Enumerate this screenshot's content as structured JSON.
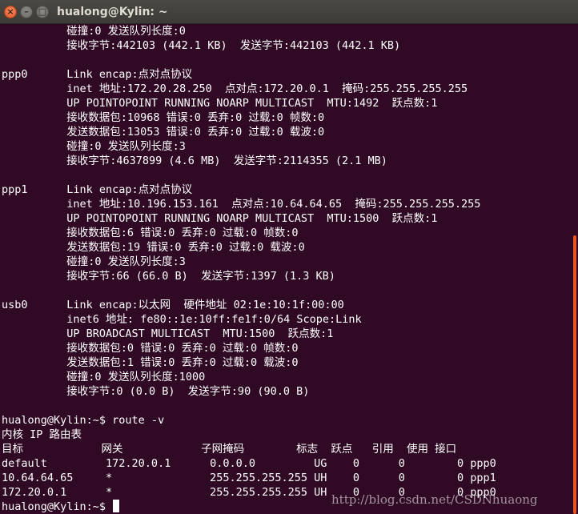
{
  "window": {
    "title": "hualong@Kylin: ~",
    "close_glyph": "×",
    "minimize_glyph": "–",
    "maximize_glyph": "□"
  },
  "terminal": {
    "lines": [
      "          碰撞:0 发送队列长度:0",
      "          接收字节:442103 (442.1 KB)  发送字节:442103 (442.1 KB)",
      "",
      "ppp0      Link encap:点对点协议",
      "          inet 地址:172.20.28.250  点对点:172.20.0.1  掩码:255.255.255.255",
      "          UP POINTOPOINT RUNNING NOARP MULTICAST  MTU:1492  跃点数:1",
      "          接收数据包:10968 错误:0 丢弃:0 过载:0 帧数:0",
      "          发送数据包:13053 错误:0 丢弃:0 过载:0 载波:0",
      "          碰撞:0 发送队列长度:3",
      "          接收字节:4637899 (4.6 MB)  发送字节:2114355 (2.1 MB)",
      "",
      "ppp1      Link encap:点对点协议",
      "          inet 地址:10.196.153.161  点对点:10.64.64.65  掩码:255.255.255.255",
      "          UP POINTOPOINT RUNNING NOARP MULTICAST  MTU:1500  跃点数:1",
      "          接收数据包:6 错误:0 丢弃:0 过载:0 帧数:0",
      "          发送数据包:19 错误:0 丢弃:0 过载:0 载波:0",
      "          碰撞:0 发送队列长度:3",
      "          接收字节:66 (66.0 B)  发送字节:1397 (1.3 KB)",
      "",
      "usb0      Link encap:以太网  硬件地址 02:1e:10:1f:00:00",
      "          inet6 地址: fe80::1e:10ff:fe1f:0/64 Scope:Link",
      "          UP BROADCAST MULTICAST  MTU:1500  跃点数:1",
      "          接收数据包:0 错误:0 丢弃:0 过载:0 帧数:0",
      "          发送数据包:1 错误:0 丢弃:0 过载:0 载波:0",
      "          碰撞:0 发送队列长度:1000",
      "          接收字节:0 (0.0 B)  发送字节:90 (90.0 B)",
      "",
      "hualong@Kylin:~$ route -v",
      "内核 IP 路由表",
      "目标            网关            子网掩码        标志  跃点   引用  使用 接口",
      "default         172.20.0.1      0.0.0.0         UG    0      0        0 ppp0",
      "10.64.64.65     *               255.255.255.255 UH    0      0        0 ppp1",
      "172.20.0.1      *               255.255.255.255 UH    0      0        0 ppp0"
    ],
    "prompt": "hualong@Kylin:~$ "
  },
  "watermark": "http://blog.csdn.net/CSDNhuaong",
  "colors": {
    "terminal_bg": "#300a24",
    "terminal_fg": "#ffffff",
    "titlebar": "#3c3b37",
    "close_button": "#e45626",
    "scrollbar": "#e95420"
  }
}
